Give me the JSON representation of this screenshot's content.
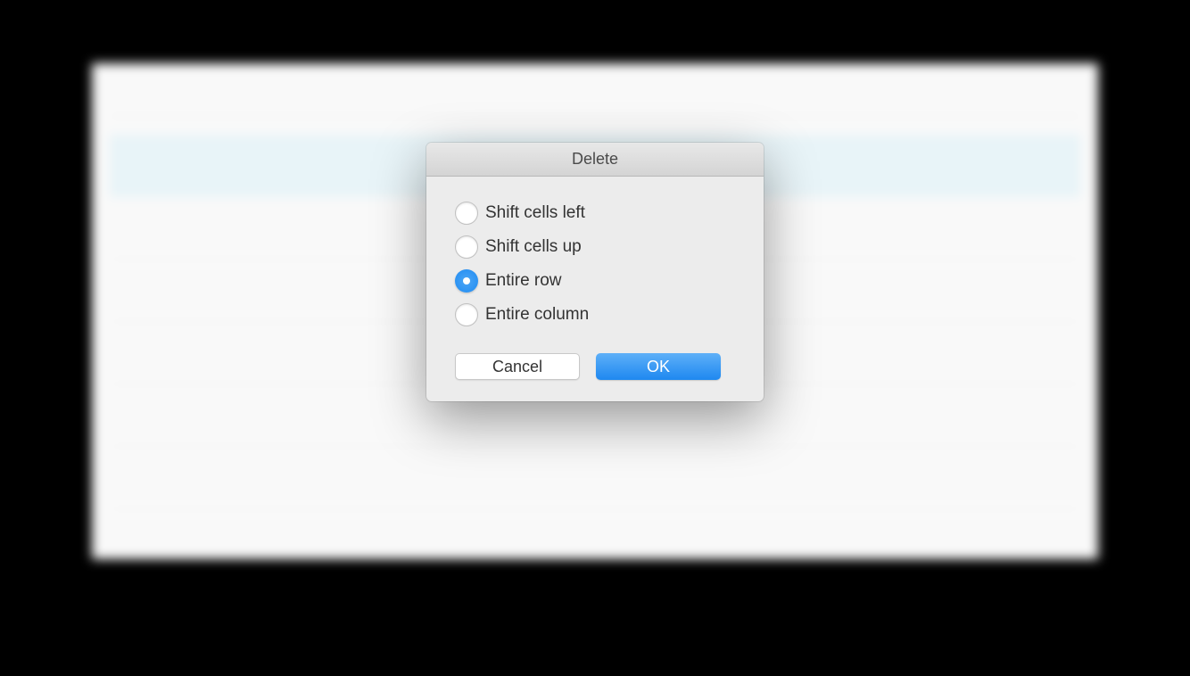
{
  "dialog": {
    "title": "Delete",
    "options": [
      {
        "label": "Shift cells left",
        "selected": false
      },
      {
        "label": "Shift cells up",
        "selected": false
      },
      {
        "label": "Entire row",
        "selected": true
      },
      {
        "label": "Entire column",
        "selected": false
      }
    ],
    "buttons": {
      "cancel": "Cancel",
      "ok": "OK"
    }
  }
}
